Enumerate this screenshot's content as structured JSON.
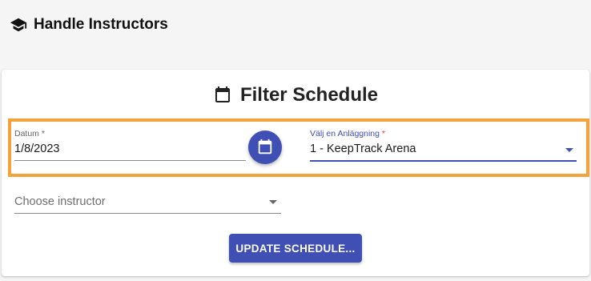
{
  "header": {
    "title": "Handle Instructors",
    "icon": "graduation-cap-icon"
  },
  "card": {
    "title": "Filter Schedule",
    "icon": "calendar-icon"
  },
  "date_field": {
    "label": "Datum *",
    "value": "1/8/2023"
  },
  "calendar_button": {
    "icon": "calendar-icon"
  },
  "facility_field": {
    "label": "Välj en Anläggning",
    "required_mark": "*",
    "value": "1 - KeepTrack Arena"
  },
  "instructor_field": {
    "placeholder": "Choose instructor"
  },
  "update_button": {
    "label": "UPDATE SCHEDULE..."
  },
  "colors": {
    "primary": "#3f4fb4",
    "highlight": "#f5a23c",
    "required": "#e53935"
  }
}
